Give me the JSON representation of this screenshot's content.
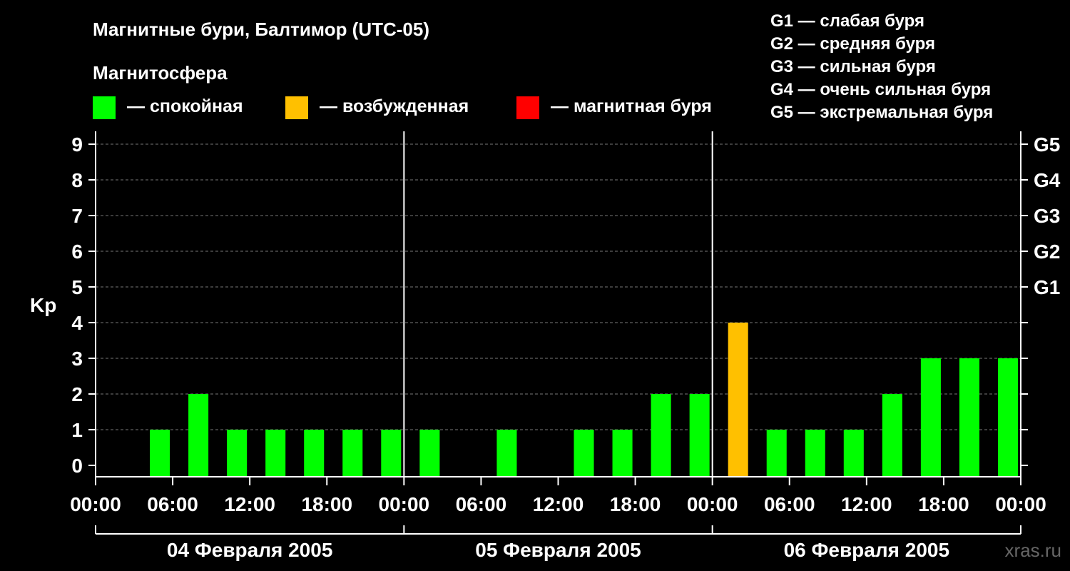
{
  "title": "Магнитные бури, Балтимор (UTC-05)",
  "legend": {
    "title": "Магнитосфера",
    "items": [
      {
        "label": "— спокойная",
        "color": "#00ff00"
      },
      {
        "label": "— возбужденная",
        "color": "#ffc000"
      },
      {
        "label": "— магнитная буря",
        "color": "#ff0000"
      }
    ]
  },
  "storm_scale": [
    "G1 — слабая буря",
    "G2 — средняя буря",
    "G3 — сильная буря",
    "G4 — очень сильная буря",
    "G5 — экстремальная буря"
  ],
  "source": "xras.ru",
  "chart_data": {
    "type": "bar",
    "ylabel": "Kp",
    "ylim": [
      0,
      9
    ],
    "y_ticks": [
      "0",
      "1",
      "2",
      "3",
      "4",
      "5",
      "6",
      "7",
      "8",
      "9"
    ],
    "right_ticks": [
      {
        "kp": 5,
        "label": "G1"
      },
      {
        "kp": 6,
        "label": "G2"
      },
      {
        "kp": 7,
        "label": "G3"
      },
      {
        "kp": 8,
        "label": "G4"
      },
      {
        "kp": 9,
        "label": "G5"
      }
    ],
    "x_ticks": [
      "00:00",
      "06:00",
      "12:00",
      "18:00",
      "00:00",
      "06:00",
      "12:00",
      "18:00",
      "00:00",
      "06:00",
      "12:00",
      "18:00",
      "00:00"
    ],
    "days": [
      "04 Февраля 2005",
      "05 Февраля 2005",
      "06 Февраля 2005"
    ],
    "grid": "dashed horizontal",
    "threshold_colors": {
      "quiet": "#00ff00",
      "active": "#ffc000",
      "storm": "#ff0000"
    },
    "series": [
      {
        "values": [
          0,
          1,
          2,
          1,
          1,
          1,
          1,
          1,
          1,
          0,
          1,
          0,
          1,
          1,
          2,
          2,
          4,
          1,
          1,
          1,
          2,
          3,
          3,
          3
        ]
      }
    ]
  }
}
